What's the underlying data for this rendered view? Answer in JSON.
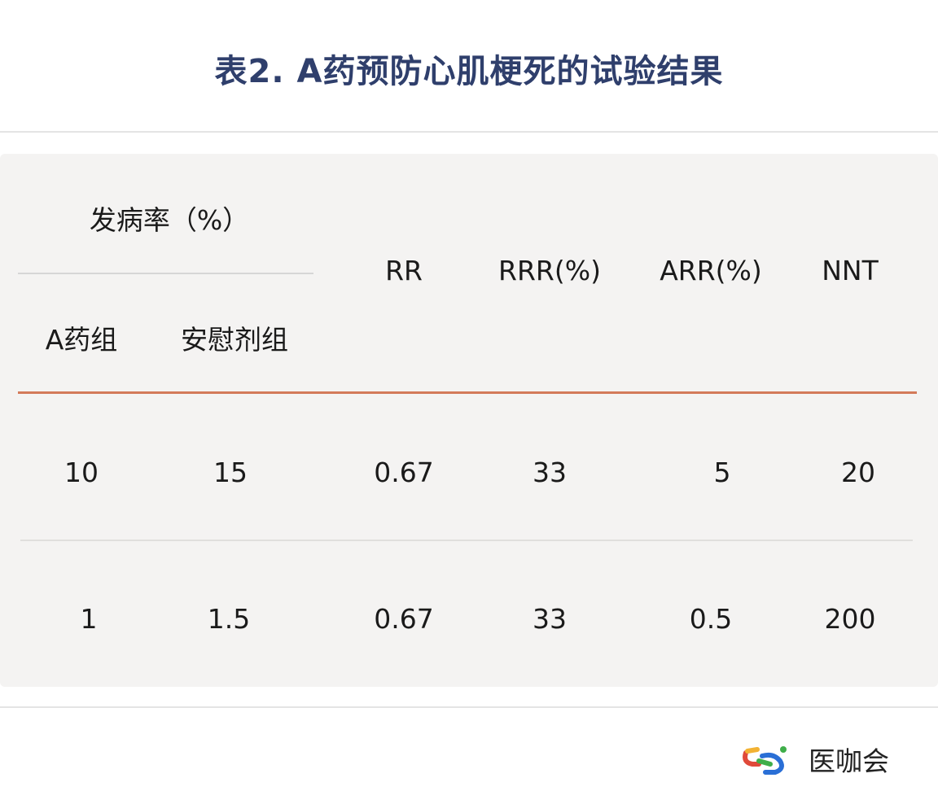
{
  "title": "表2. A药预防心肌梗死的试验结果",
  "header": {
    "group": "发病率（%）",
    "col_a": "A药组",
    "col_placebo": "安慰剂组",
    "rr": "RR",
    "rrr": "RRR(%)",
    "arr": "ARR(%)",
    "nnt": "NNT"
  },
  "rows": [
    {
      "a": "10",
      "placebo": "15",
      "rr": "0.67",
      "rrr": "33",
      "arr": "5",
      "nnt": "20"
    },
    {
      "a": "1",
      "placebo": "1.5",
      "rr": "0.67",
      "rrr": "33",
      "arr": "0.5",
      "nnt": "200"
    }
  ],
  "brand": {
    "name": "医咖会",
    "icon": "link-chain-icon"
  },
  "colors": {
    "title": "#2f3f6c",
    "accent_line": "#d37a5a",
    "panel": "#f4f3f2"
  }
}
